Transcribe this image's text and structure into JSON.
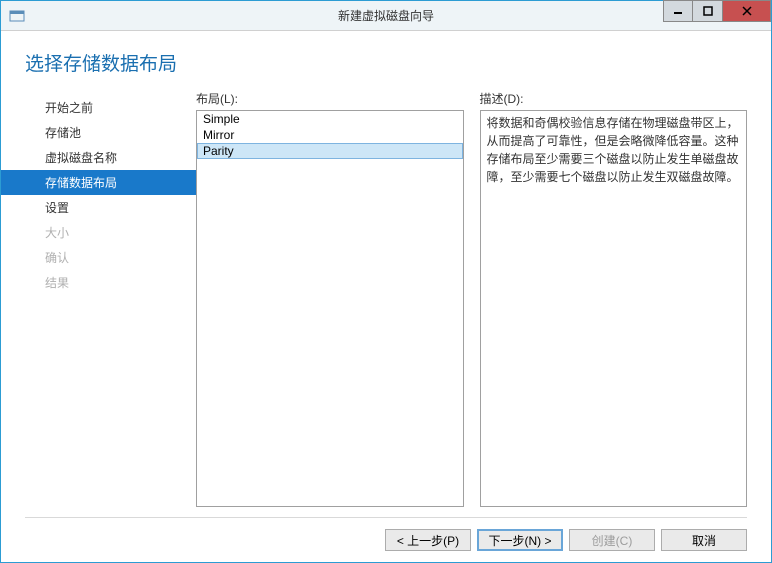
{
  "window": {
    "title": "新建虚拟磁盘向导"
  },
  "heading": "选择存储数据布局",
  "nav": {
    "items": [
      {
        "label": "开始之前",
        "state": "done"
      },
      {
        "label": "存储池",
        "state": "done"
      },
      {
        "label": "虚拟磁盘名称",
        "state": "done"
      },
      {
        "label": "存储数据布局",
        "state": "active"
      },
      {
        "label": "设置",
        "state": "pending"
      },
      {
        "label": "大小",
        "state": "disabled"
      },
      {
        "label": "确认",
        "state": "disabled"
      },
      {
        "label": "结果",
        "state": "disabled"
      }
    ]
  },
  "layout": {
    "label": "布局(L):",
    "options": [
      {
        "name": "Simple",
        "selected": false
      },
      {
        "name": "Mirror",
        "selected": false
      },
      {
        "name": "Parity",
        "selected": true
      }
    ]
  },
  "description": {
    "label": "描述(D):",
    "text": "将数据和奇偶校验信息存储在物理磁盘带区上，从而提高了可靠性，但是会略微降低容量。这种存储布局至少需要三个磁盘以防止发生单磁盘故障，至少需要七个磁盘以防止发生双磁盘故障。"
  },
  "buttons": {
    "prev": "< 上一步(P)",
    "next": "下一步(N) >",
    "create": "创建(C)",
    "cancel": "取消"
  }
}
